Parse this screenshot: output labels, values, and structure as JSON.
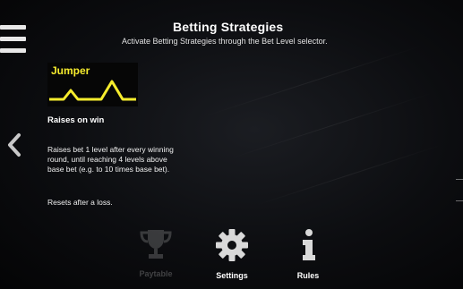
{
  "header": {
    "title": "Betting Strategies",
    "subtitle": "Activate Betting Strategies through the Bet Level selector."
  },
  "strategy": {
    "card_label": "Jumper",
    "name": "Raises on win",
    "description": "Raises bet 1 level after every winning round, until reaching 4 levels above base bet (e.g. to 10 times base bet).",
    "reset_note": "Resets after a loss."
  },
  "bottom_nav": {
    "paytable": "Paytable",
    "settings": "Settings",
    "rules": "Rules"
  },
  "colors": {
    "accent_yellow": "#f6ec2d",
    "icon_grey": "#d9d9d9"
  },
  "icons": [
    "menu-icon",
    "chevron-left-icon",
    "trophy-icon",
    "gear-icon",
    "info-icon"
  ]
}
